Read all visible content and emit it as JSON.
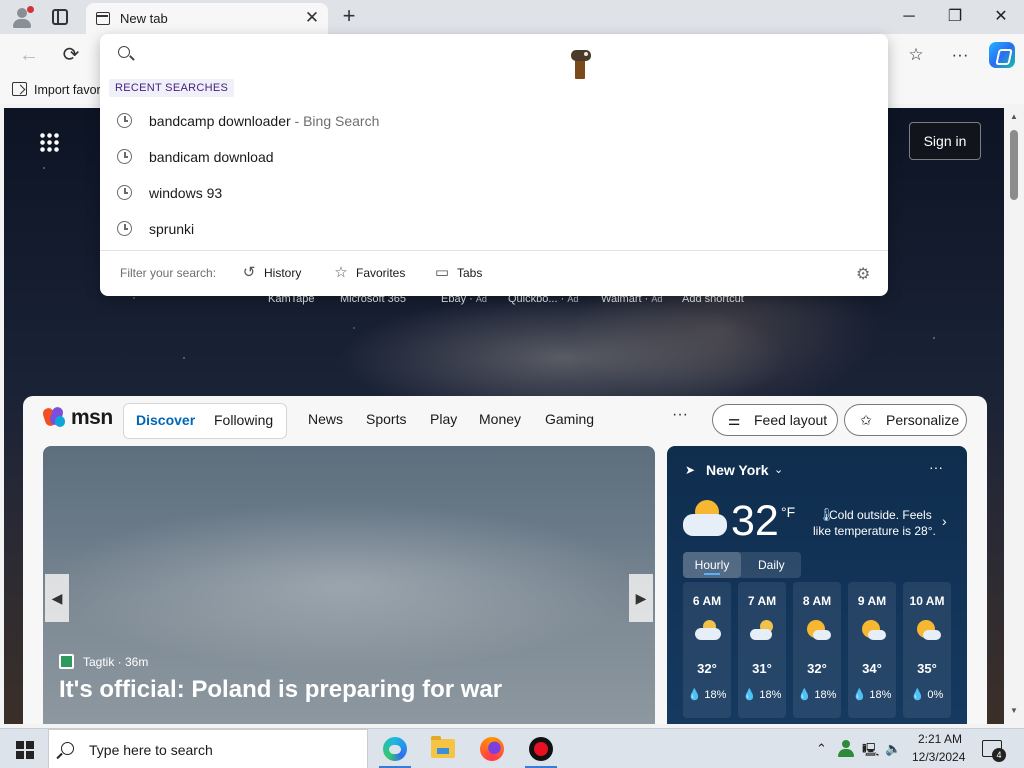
{
  "tab": {
    "title": "New tab",
    "close": "✕",
    "new": "+"
  },
  "window": {
    "minimize": "─",
    "maximize": "❐",
    "close": "✕"
  },
  "toolbar": {
    "back": "←",
    "refresh": "⟳",
    "favorites_star": "☆",
    "more": "···"
  },
  "favorites_bar": {
    "import_label": "Import favor"
  },
  "dropdown": {
    "placeholder": "",
    "section_title": "RECENT SEARCHES",
    "items": [
      {
        "query": "bandcamp downloader",
        "source": " - Bing Search"
      },
      {
        "query": "bandicam download",
        "source": ""
      },
      {
        "query": "windows 93",
        "source": ""
      },
      {
        "query": "sprunki",
        "source": ""
      }
    ],
    "filter_label": "Filter your search:",
    "filters": [
      {
        "label": "History",
        "icon": "history-icon"
      },
      {
        "label": "Favorites",
        "icon": "star-icon"
      },
      {
        "label": "Tabs",
        "icon": "tabs-icon"
      }
    ]
  },
  "newtab": {
    "sign_in": "Sign in",
    "quick_links": [
      {
        "label": "KamTape",
        "ad": ""
      },
      {
        "label": "Microsoft 365",
        "ad": ""
      },
      {
        "label": "Ebay",
        "ad": "Ad"
      },
      {
        "label": "Quickbo...",
        "ad": "Ad"
      },
      {
        "label": "Walmart",
        "ad": "Ad"
      },
      {
        "label": "Add shortcut",
        "ad": ""
      }
    ]
  },
  "msn": {
    "logo": "msn",
    "tabs": [
      "Discover",
      "Following"
    ],
    "nav": [
      "News",
      "Sports",
      "Play",
      "Money",
      "Gaming"
    ],
    "more": "···",
    "feed_layout": "Feed layout",
    "personalize": "Personalize",
    "accent": "#0067b8",
    "hero": {
      "source": "Tagtik · 36m",
      "title": "It's official: Poland is preparing for war"
    }
  },
  "weather": {
    "location": "New York",
    "temp": "32",
    "unit": "°F",
    "desc": "Cold outside. Feels like temperature is 28°.",
    "tabs": [
      "Hourly",
      "Daily"
    ],
    "hours": [
      {
        "time": "6 AM",
        "temp": "32°",
        "precip": "💧 18%",
        "icon": "partly-cloudy-night-icon"
      },
      {
        "time": "7 AM",
        "temp": "31°",
        "precip": "💧 18%",
        "icon": "partly-cloudy-moon-icon"
      },
      {
        "time": "8 AM",
        "temp": "32°",
        "precip": "💧 18%",
        "icon": "partly-sunny-icon"
      },
      {
        "time": "9 AM",
        "temp": "34°",
        "precip": "💧 18%",
        "icon": "partly-sunny-icon"
      },
      {
        "time": "10 AM",
        "temp": "35°",
        "precip": "💧 0%",
        "icon": "partly-sunny-icon"
      }
    ]
  },
  "taskbar": {
    "search_placeholder": "Type here to search",
    "time": "2:21 AM",
    "date": "12/3/2024",
    "notifications": "4"
  }
}
